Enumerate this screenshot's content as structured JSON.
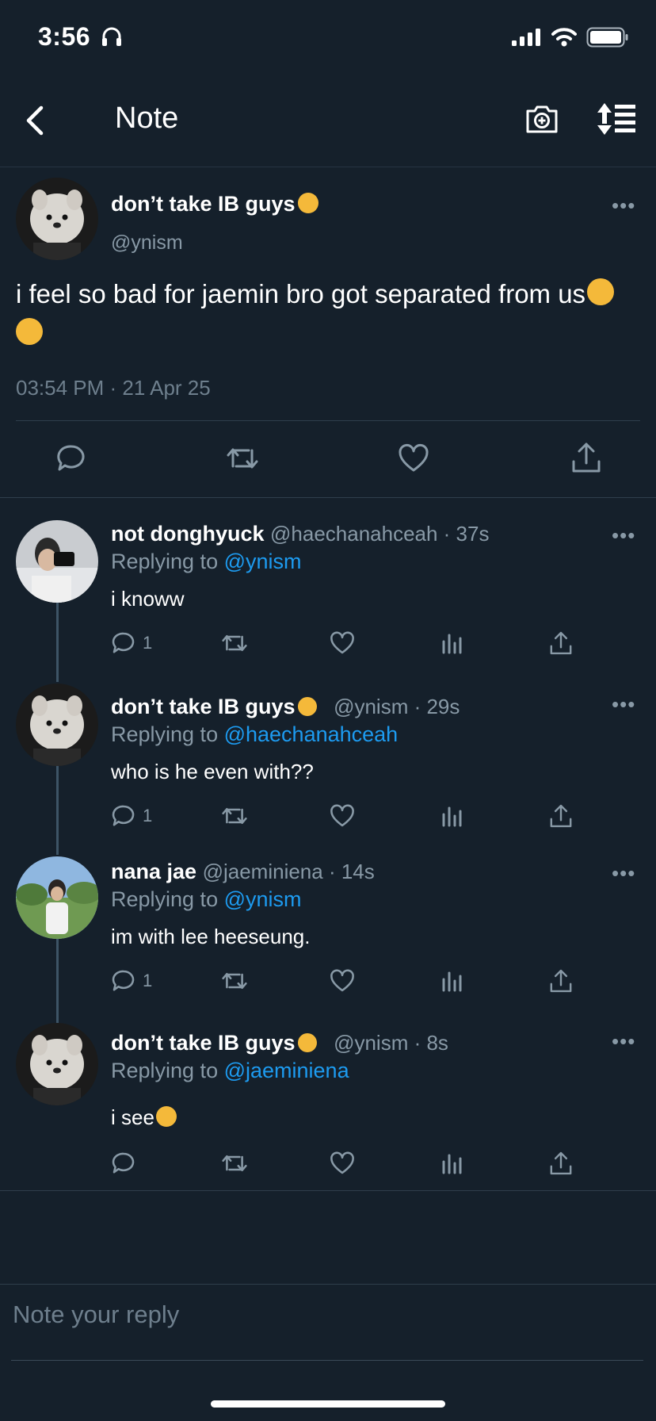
{
  "status_bar": {
    "time": "3:56"
  },
  "header": {
    "title": "Note"
  },
  "main_tweet": {
    "author": "don’t take IB guys",
    "handle": "@ynism",
    "text": "i feel so bad for jaemin bro got separated from us",
    "timestamp": "03:54 PM · 21 Apr 25"
  },
  "replies": [
    {
      "author": "not donghyuck",
      "meta": "@haechanahceah · 37s",
      "replying_prefix": "Replying to ",
      "replying_to": "@ynism",
      "text": "i knoww",
      "reply_count": "1"
    },
    {
      "author": "don’t take IB guys",
      "meta": "@ynism · 29s",
      "replying_prefix": "Replying to ",
      "replying_to": "@haechanahceah",
      "text": "who is he even with??",
      "reply_count": "1"
    },
    {
      "author": "nana jae",
      "meta": "@jaeminiena · 14s",
      "replying_prefix": "Replying to ",
      "replying_to": "@ynism",
      "text": "im with lee heeseung.",
      "reply_count": "1"
    },
    {
      "author": "don’t take IB guys",
      "meta": "@ynism · 8s",
      "replying_prefix": "Replying to ",
      "replying_to": "@jaeminiena",
      "text": "i see",
      "reply_count": ""
    }
  ],
  "compose": {
    "placeholder": "Note your reply"
  },
  "colors": {
    "background": "#15202b",
    "accent": "#1d9bf0",
    "muted": "#8899a6"
  },
  "icons": [
    "headphones-icon",
    "signal-icon",
    "wifi-icon",
    "battery-icon",
    "back-arrow-icon",
    "camera-plus-icon",
    "sort-icon",
    "more-icon",
    "reply-icon",
    "retweet-icon",
    "like-icon",
    "analytics-icon",
    "share-icon"
  ]
}
